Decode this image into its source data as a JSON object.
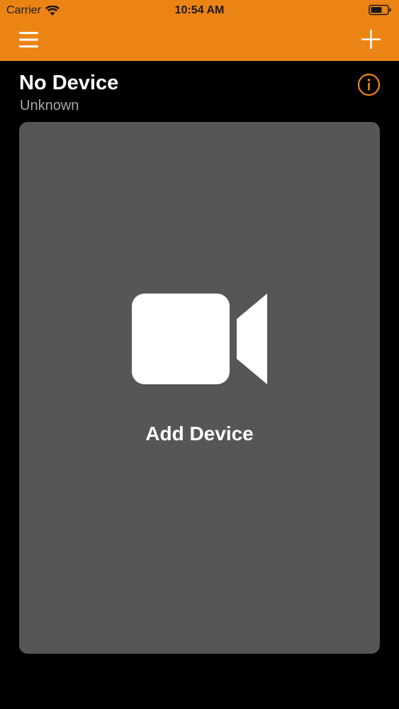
{
  "status_bar": {
    "carrier": "Carrier",
    "time": "10:54 AM",
    "wifi_icon": "wifi-icon",
    "battery_icon": "battery-icon"
  },
  "nav": {
    "menu_icon": "hamburger-menu-icon",
    "add_icon": "plus-icon"
  },
  "device": {
    "name": "No Device",
    "status": "Unknown",
    "info_icon": "info-icon"
  },
  "card": {
    "icon": "video-camera-icon",
    "label": "Add Device"
  },
  "colors": {
    "accent": "#ec8415",
    "background": "#000000",
    "card": "#565658",
    "subtitle": "#a8a8a8"
  }
}
